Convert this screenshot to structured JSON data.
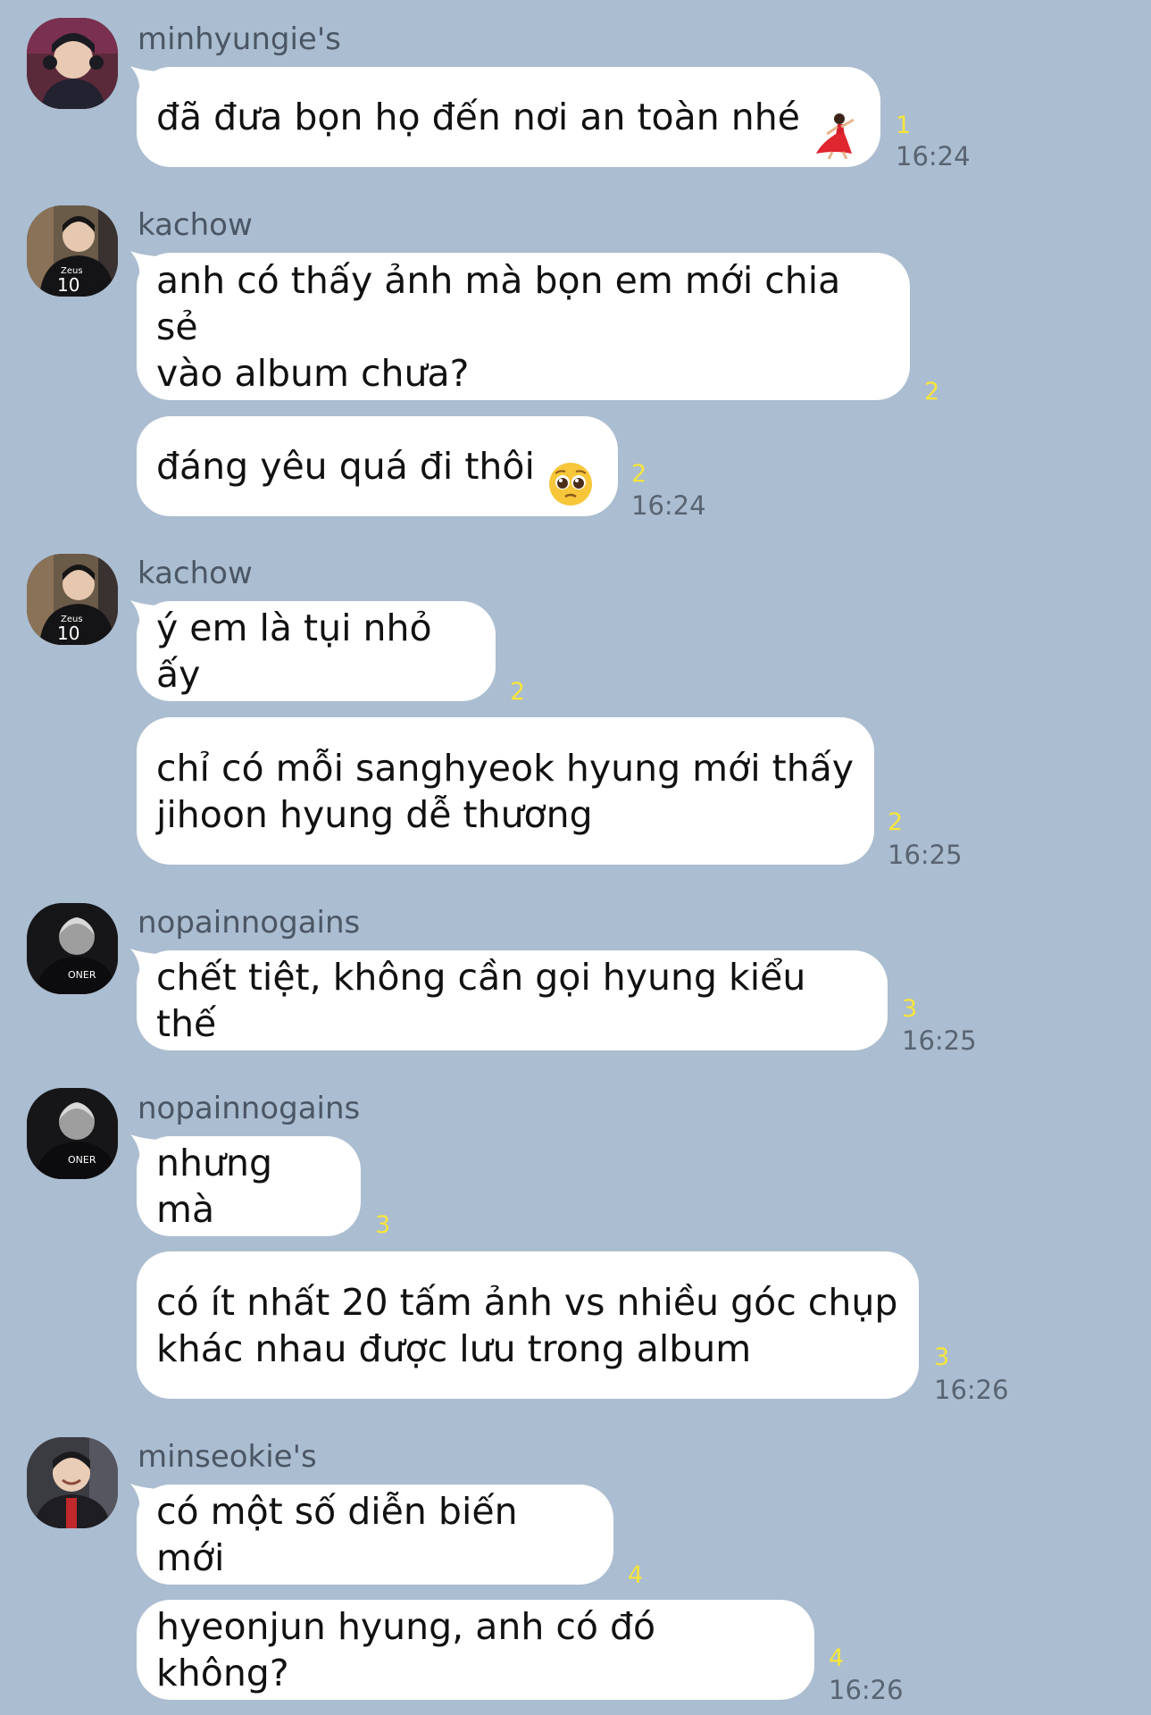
{
  "messages": [
    {
      "sender": "minhyungie's",
      "text": "đã đưa bọn họ đến nơi an toàn nhé",
      "emoji": "dancer-emoji",
      "unread": "1",
      "time": "16:24"
    },
    {
      "sender": "kachow",
      "text": "anh có thấy ảnh mà bọn em mới chia sẻ\nvào album chưa?",
      "unread": "2"
    },
    {
      "text": "đáng yêu quá đi thôi",
      "emoji": "pleading-face-emoji",
      "unread": "2",
      "time": "16:24"
    },
    {
      "sender": "kachow",
      "text": "ý em là tụi nhỏ ấy",
      "unread": "2"
    },
    {
      "text": "chỉ có mỗi sanghyeok hyung mới thấy\njihoon hyung dễ thương",
      "unread": "2",
      "time": "16:25"
    },
    {
      "sender": "nopainnogains",
      "text": "chết tiệt, không cần gọi hyung kiểu thế",
      "unread": "3",
      "time": "16:25"
    },
    {
      "sender": "nopainnogains",
      "text": "nhưng mà",
      "unread": "3"
    },
    {
      "text": "có ít nhất 20 tấm ảnh vs nhiều góc chụp\nkhác nhau được lưu trong album",
      "unread": "3",
      "time": "16:26"
    },
    {
      "sender": "minseokie's",
      "text": "có một số diễn biến mới",
      "unread": "4"
    },
    {
      "text": "hyeonjun hyung, anh có đó không?",
      "unread": "4",
      "time": "16:26"
    }
  ],
  "avatars": {
    "jersey_1": "Zeus",
    "jersey_1_number": "10",
    "jersey_2": "ONER"
  },
  "colors": {
    "background": "#abbdd0",
    "bubble": "#ffffff",
    "unread": "#f6e53c",
    "time": "#596472",
    "sender": "#4b5665"
  }
}
